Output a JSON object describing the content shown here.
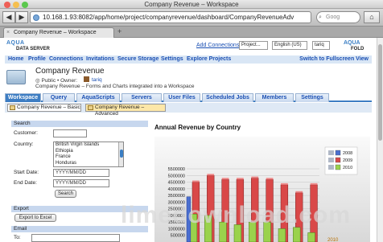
{
  "window": {
    "title": "Company Revenue – Workspace"
  },
  "browser": {
    "url": "10.168.1.93:8082/app/home/project/companyrevenue/dashboard/CompanyRevenueAdv",
    "search_placeholder": "Goog",
    "tab_title": "Company Revenue – Workspace",
    "new_tab": "+",
    "back": "◀",
    "forward": "▶"
  },
  "header": {
    "logo_top": "AQUA",
    "logo_bottom": "DATA SERVER",
    "add_connections": "Add Connections",
    "project_select": "Project...",
    "language_select": "English (US)",
    "user_select": "tariq",
    "right_logo_top": "AQUA",
    "right_logo_bottom": "FOLD"
  },
  "nav": {
    "items": [
      "Home",
      "Profile",
      "Connections",
      "Invitations",
      "Secure Storage",
      "Settings",
      "Explore Projects"
    ],
    "fullscreen": "Switch to Fullscreen View"
  },
  "project": {
    "title": "Company Revenue",
    "visibility": "Public",
    "owner_label": "Owner:",
    "owner": "tariq",
    "description": "Company Revenue – Forms and Charts integrated into a Workspace"
  },
  "tabs": [
    "Workspace",
    "Query",
    "AquaScripts",
    "Servers",
    "User Files",
    "Scheduled Jobs",
    "Members",
    "Settings"
  ],
  "subtabs": [
    "Company Revenue – Basic",
    "Company Revenue – Advanced"
  ],
  "search_panel": {
    "title": "Search",
    "customer_label": "Customer:",
    "customer_value": "",
    "country_label": "Country:",
    "countries": [
      "British Virgin Islands",
      "Ethiopia",
      "France",
      "Honduras"
    ],
    "start_label": "Start Date:",
    "start_value": "YYYY/MM/DD",
    "end_label": "End Date:",
    "end_value": "YYYY/MM/DD",
    "search_button": "Search"
  },
  "export_panel": {
    "title": "Export",
    "button": "Export to Excel"
  },
  "email_panel": {
    "title": "Email",
    "to_label": "To:"
  },
  "watermark": "limedownload.com",
  "chart_data": {
    "type": "bar",
    "title": "Annual Revenue by Country",
    "ylim": [
      0,
      5500000
    ],
    "yticks": [
      "5500000",
      "5000000",
      "4500000",
      "4000000",
      "3500000",
      "3000000",
      "2500000",
      "2000000",
      "1500000",
      "1000000",
      "500000"
    ],
    "categories": [
      "",
      "",
      "",
      "",
      "",
      "",
      "",
      "",
      ""
    ],
    "series": [
      {
        "name": "2008",
        "color": "#4a6fd0",
        "values": [
          3400000,
          0,
          0,
          0,
          0,
          0,
          0,
          0,
          0
        ]
      },
      {
        "name": "2009",
        "color": "#d94848",
        "values": [
          4500000,
          5000000,
          4700000,
          4700000,
          4800000,
          4700000,
          4300000,
          3700000,
          4300000
        ]
      },
      {
        "name": "2010",
        "color": "#9ad24c",
        "values": [
          2100000,
          2000000,
          1500000,
          1300000,
          1500000,
          1500000,
          1000000,
          1100000,
          700000
        ]
      }
    ],
    "x_label_visible": "2010",
    "legend": "top-right"
  }
}
